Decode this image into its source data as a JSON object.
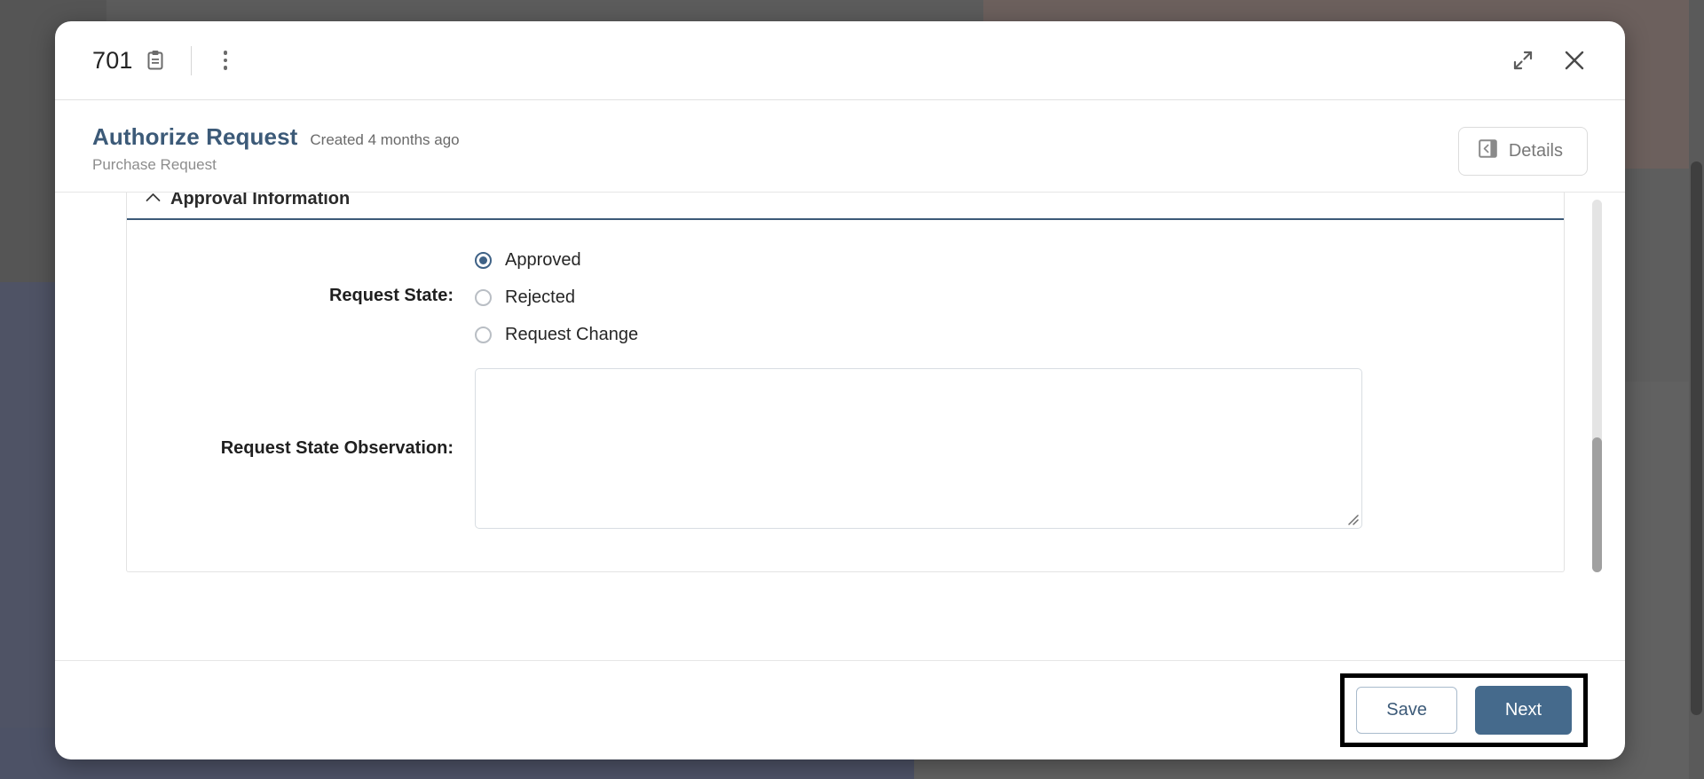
{
  "window": {
    "record_id": "701",
    "clipboard_icon": "clipboard-icon",
    "kebab_icon": "more-vertical-icon",
    "expand_icon": "expand-icon",
    "close_icon": "close-icon"
  },
  "header": {
    "title": "Authorize Request",
    "created": "Created 4 months ago",
    "subtitle": "Purchase Request",
    "details_label": "Details",
    "details_icon": "panel-toggle-icon"
  },
  "section": {
    "title": "Approval Information",
    "collapse_icon": "chevron-up-icon",
    "accent_color": "#3c5a78"
  },
  "form": {
    "request_state": {
      "label": "Request State:",
      "selected": "Approved",
      "options": [
        {
          "label": "Approved",
          "checked": true
        },
        {
          "label": "Rejected",
          "checked": false
        },
        {
          "label": "Request Change",
          "checked": false
        }
      ]
    },
    "observation": {
      "label": "Request State Observation:",
      "value": "",
      "placeholder": ""
    }
  },
  "footer": {
    "save_label": "Save",
    "next_label": "Next",
    "next_color": "#456a8c"
  }
}
